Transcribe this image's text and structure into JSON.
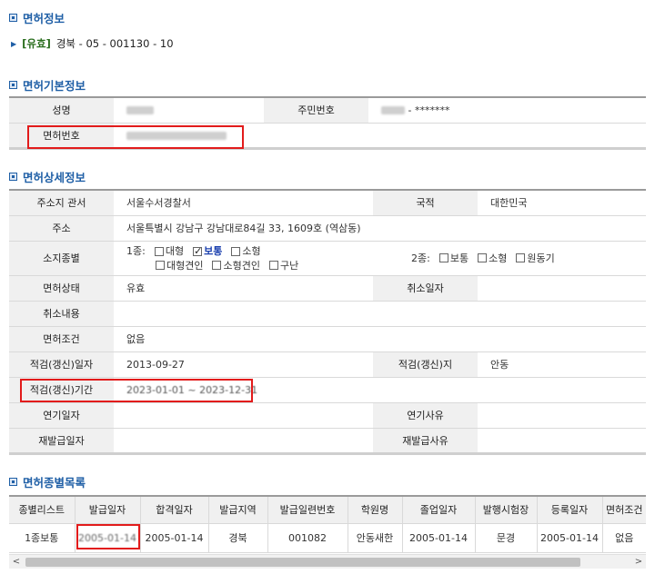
{
  "sections": {
    "license_info": "면허정보",
    "basic_info": "면허기본정보",
    "detail_info": "면허상세정보",
    "type_list": "면허종별목록"
  },
  "license": {
    "status": "[유효]",
    "number": "경북 - 05 - 001130 - 10"
  },
  "basic": {
    "name_label": "성명",
    "rrn_label": "주민번호",
    "rrn_value": "- *******",
    "license_no_label": "면허번호"
  },
  "detail": {
    "jurisdiction_label": "주소지 관서",
    "jurisdiction_value": "서울수서경찰서",
    "nationality_label": "국적",
    "nationality_value": "대한민국",
    "address_label": "주소",
    "address_value": "서울특별시 강남구 강남대로84길 33, 1609호 (역삼동)",
    "license_type_label": "소지종별",
    "class1_label": "1종:",
    "class1_options": [
      "대형",
      "보통",
      "소형",
      "대형견인",
      "소형견인",
      "구난"
    ],
    "class2_label": "2종:",
    "class2_options": [
      "보통",
      "소형",
      "원동기"
    ],
    "state_label": "면허상태",
    "state_value": "유효",
    "cancel_date_label": "취소일자",
    "cancel_content_label": "취소내용",
    "condition_label": "면허조건",
    "condition_value": "없음",
    "renew_date_label": "적검(갱신)일자",
    "renew_date_value": "2013-09-27",
    "renew_place_label": "적검(갱신)지",
    "renew_place_value": "안동",
    "renew_period_label": "적검(갱신)기간",
    "renew_period_value": "2023-01-01 ~ 2023-12-31",
    "extend_date_label": "연기일자",
    "extend_reason_label": "연기사유",
    "reissue_date_label": "재발급일자",
    "reissue_reason_label": "재발급사유"
  },
  "type_table": {
    "headers": [
      "종별리스트",
      "발급일자",
      "합격일자",
      "발급지역",
      "발급일련번호",
      "학원명",
      "졸업일자",
      "발행시험장",
      "등록일자",
      "면허조건"
    ],
    "rows": [
      [
        "1종보통",
        "2005-01-14",
        "2005-01-14",
        "경북",
        "001082",
        "안동새한",
        "2005-01-14",
        "문경",
        "2005-01-14",
        "없음"
      ]
    ]
  },
  "scroll": {
    "left": "<",
    "right": ">"
  },
  "colors": {
    "accent": "#1f5fa6",
    "highlight": "#e21b1b",
    "header_bg": "#f0f0f0"
  }
}
